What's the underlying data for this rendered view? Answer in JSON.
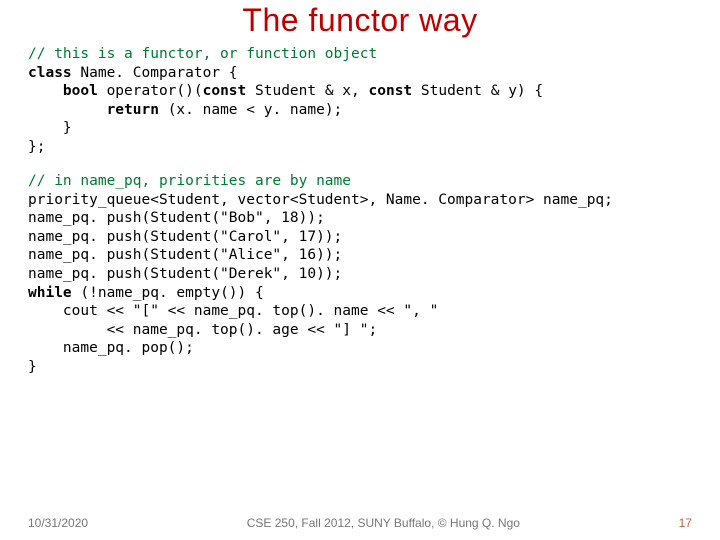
{
  "title": "The functor way",
  "code": {
    "c1": "// this is a functor, or function object",
    "l2a": "class ",
    "l2b": "Name. Comparator {",
    "l3a": "    bool ",
    "l3b": "operator()(",
    "l3c": "const ",
    "l3d": "Student & x, ",
    "l3e": "const ",
    "l3f": "Student & y) {",
    "l4a": "         return ",
    "l4b": "(x. name < y. name);",
    "l5": "    }",
    "l6": "};",
    "c7": "// in name_pq, priorities are by name",
    "l8": "priority_queue<Student, vector<Student>, Name. Comparator> name_pq;",
    "l9": "name_pq. push(Student(\"Bob\", 18));",
    "l10": "name_pq. push(Student(\"Carol\", 17));",
    "l11": "name_pq. push(Student(\"Alice\", 16));",
    "l12": "name_pq. push(Student(\"Derek\", 10));",
    "l13a": "while ",
    "l13b": "(!name_pq. empty()) {",
    "l14": "    cout << \"[\" << name_pq. top(). name << \", \"",
    "l15": "         << name_pq. top(). age << \"] \";",
    "l16": "    name_pq. pop();",
    "l17": "}"
  },
  "footer": {
    "date": "10/31/2020",
    "center": "CSE 250, Fall 2012, SUNY Buffalo, © Hung Q. Ngo",
    "page": "17"
  }
}
